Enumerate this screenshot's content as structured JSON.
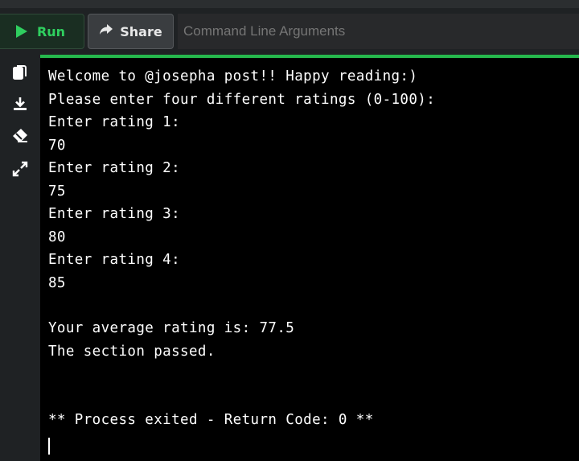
{
  "toolbar": {
    "run_label": "Run",
    "share_label": "Share",
    "args_placeholder": "Command Line Arguments"
  },
  "sidebar": {
    "icons": [
      "copy-icon",
      "download-icon",
      "eraser-icon",
      "expand-icon"
    ]
  },
  "terminal": {
    "lines": [
      "Welcome to @josepha post!! Happy reading:)",
      "Please enter four different ratings (0-100):",
      "Enter rating 1:",
      "70",
      "Enter rating 2:",
      "75",
      "Enter rating 3:",
      "80",
      "Enter rating 4:",
      "85",
      "",
      "Your average rating is: 77.5",
      "The section passed.",
      "",
      "",
      "** Process exited - Return Code: 0 **"
    ]
  },
  "colors": {
    "accent_green": "#26b84d",
    "run_text": "#2fcf5f",
    "terminal_bg": "#000000"
  }
}
